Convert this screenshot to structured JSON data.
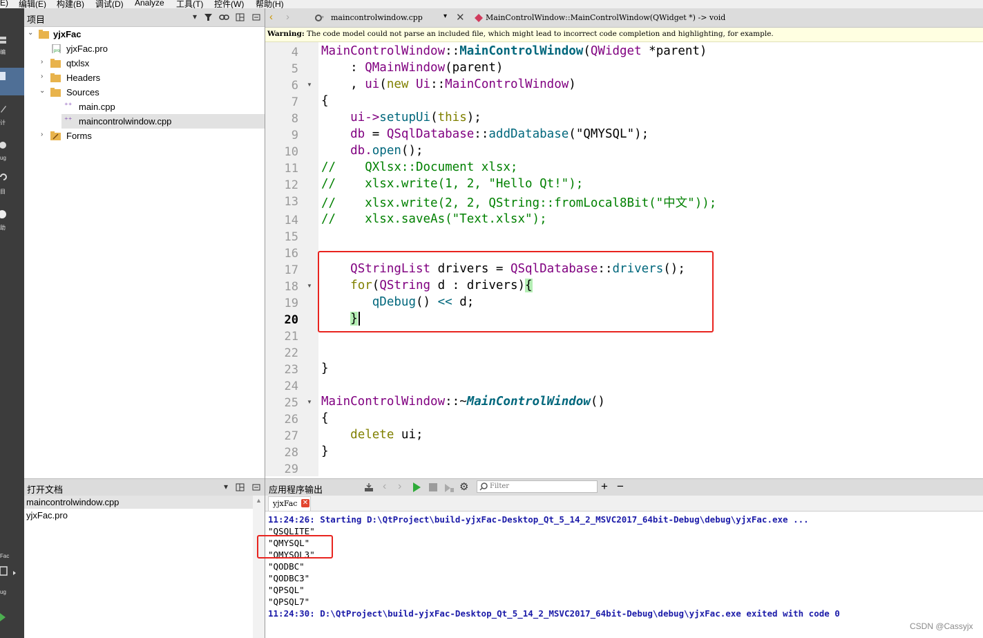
{
  "menu": [
    "编辑(E)",
    "构建(B)",
    "调试(D)",
    "Analyze",
    "工具(T)",
    "控件(W)",
    "帮助(H)"
  ],
  "menu_edge": "E)",
  "modes": [
    {
      "label": "编辑",
      "icon": "edit-icon"
    },
    {
      "label": "设计",
      "icon": "design-icon"
    },
    {
      "label": "Debug",
      "icon": "debug-icon"
    },
    {
      "label": "项目",
      "icon": "projects-icon"
    },
    {
      "label": "帮助",
      "icon": "help-icon"
    }
  ],
  "mode_fragments": [
    "编",
    "计",
    "ug",
    "目",
    "助",
    "Fac",
    "ug"
  ],
  "project_pane": {
    "title": "项目",
    "tree": [
      {
        "label": "yjxFac",
        "type": "project",
        "expanded": true
      },
      {
        "label": "yjxFac.pro",
        "type": "pro-file"
      },
      {
        "label": "qtxlsx",
        "type": "folder",
        "expanded": false
      },
      {
        "label": "Headers",
        "type": "folder",
        "expanded": false
      },
      {
        "label": "Sources",
        "type": "folder",
        "expanded": true
      },
      {
        "label": "main.cpp",
        "type": "cpp-file"
      },
      {
        "label": "maincontrolwindow.cpp",
        "type": "cpp-file",
        "selected": true
      },
      {
        "label": "Forms",
        "type": "folder",
        "expanded": false
      }
    ]
  },
  "open_documents": {
    "title": "打开文档",
    "items": [
      "maincontrolwindow.cpp",
      "yjxFac.pro"
    ]
  },
  "editor": {
    "file_combo": "maincontrolwindow.cpp",
    "symbol_combo": "MainControlWindow::MainControlWindow(QWidget *) -> void",
    "warning_label": "Warning:",
    "warning_text": "The code model could not parse an included file, which might lead to incorrect code completion and highlighting, for example.",
    "current_line": "20",
    "line_numbers": [
      "4",
      "5",
      "6",
      "7",
      "8",
      "9",
      "10",
      "11",
      "12",
      "13",
      "14",
      "15",
      "16",
      "17",
      "18",
      "19",
      "20",
      "21",
      "22",
      "23",
      "24",
      "25",
      "26",
      "27",
      "28",
      "29"
    ],
    "code": {
      "l4": [
        "MainControlWindow",
        "::",
        "MainControlWindow",
        "(",
        "QWidget",
        " *parent)"
      ],
      "l5": [
        "    : ",
        "QMainWindow",
        "(parent)"
      ],
      "l6": [
        "    , ",
        "ui",
        "(",
        "new",
        " ",
        "Ui",
        "::",
        "MainControlWindow",
        ")"
      ],
      "l7": [
        "{"
      ],
      "l8": [
        "    ui->",
        "setupUi",
        "(",
        "this",
        ");"
      ],
      "l9": [
        "    db ",
        "=",
        " ",
        "QSqlDatabase",
        "::",
        "addDatabase",
        "(",
        "\"QMYSQL\"",
        ");"
      ],
      "l10": [
        "    db.",
        "open",
        "();"
      ],
      "l11": [
        "//    QXlsx::Document xlsx;"
      ],
      "l12": [
        "//    xlsx.write(1, 2, \"Hello Qt!\");"
      ],
      "l13": [
        "//    xlsx.write(2, 2, QString::fromLocal8Bit(\"中文\"));"
      ],
      "l14": [
        "//    xlsx.saveAs(\"Text.xlsx\");"
      ],
      "l17": [
        "    ",
        "QStringList",
        " drivers ",
        "=",
        " ",
        "QSqlDatabase",
        "::",
        "drivers",
        "();"
      ],
      "l18": [
        "    ",
        "for",
        "(",
        "QString",
        " d : drivers)",
        "{"
      ],
      "l19": [
        "       ",
        "qDebug",
        "() ",
        "<<",
        " d;"
      ],
      "l20": [
        "    ",
        "}"
      ],
      "l23": [
        "}"
      ],
      "l25": [
        "MainControlWindow",
        "::~",
        "MainControlWindow",
        "()"
      ],
      "l26": [
        "{"
      ],
      "l27": [
        "    ",
        "delete",
        " ui;"
      ],
      "l28": [
        "}"
      ]
    }
  },
  "output_pane": {
    "title": "应用程序输出",
    "filter_placeholder": "Filter",
    "tab_label": "yjxFac",
    "lines": [
      {
        "text": "11:24:26: Starting D:\\QtProject\\build-yjxFac-Desktop_Qt_5_14_2_MSVC2017_64bit-Debug\\debug\\yjxFac.exe ...",
        "style": "blue"
      },
      {
        "text": "\"QSQLITE\"",
        "style": "normal"
      },
      {
        "text": "\"QMYSQL\"",
        "style": "normal"
      },
      {
        "text": "\"QMYSQL3\"",
        "style": "normal"
      },
      {
        "text": "\"QODBC\"",
        "style": "normal"
      },
      {
        "text": "\"QODBC3\"",
        "style": "normal"
      },
      {
        "text": "\"QPSQL\"",
        "style": "normal"
      },
      {
        "text": "\"QPSQL7\"",
        "style": "normal"
      },
      {
        "text": "11:24:30: D:\\QtProject\\build-yjxFac-Desktop_Qt_5_14_2_MSVC2017_64bit-Debug\\debug\\yjxFac.exe exited with code 0",
        "style": "blue"
      }
    ]
  },
  "watermark": "CSDN @Cassyjx",
  "colors": {
    "keyword": "#808000",
    "type": "#800080",
    "function_decl": "#00677c",
    "string": "#008000",
    "comment": "#008000",
    "highlight_box": "#e8231e",
    "output_status": "#1a1aa8"
  }
}
